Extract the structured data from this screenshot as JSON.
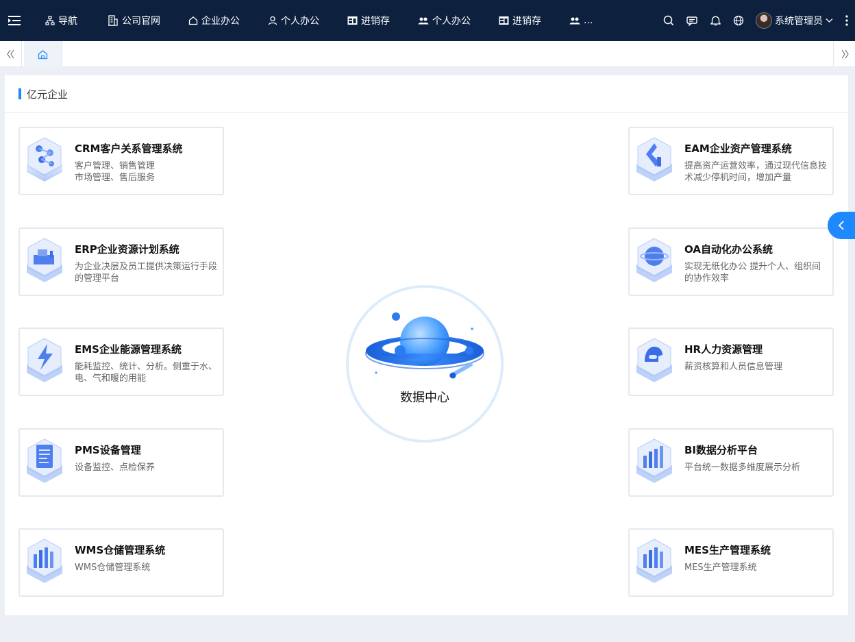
{
  "nav": {
    "items": [
      {
        "label": "导航",
        "icon": "sitemap-icon"
      },
      {
        "label": "公司官网",
        "icon": "building-icon"
      },
      {
        "label": "企业办公",
        "icon": "home-icon"
      },
      {
        "label": "个人办公",
        "icon": "user-icon"
      },
      {
        "label": "进销存",
        "icon": "board-icon"
      },
      {
        "label": "个人办公",
        "icon": "users-icon"
      },
      {
        "label": "进销存",
        "icon": "board-icon"
      },
      {
        "label": "...",
        "icon": "users-icon"
      }
    ]
  },
  "user": {
    "name": "系统管理员"
  },
  "panel": {
    "title": "亿元企业"
  },
  "center": {
    "title": "数据中心"
  },
  "cards_left": [
    {
      "title": "CRM客户关系管理系统",
      "desc": "客户管理、销售管理\n市场管理、售后服务",
      "icon": "crm-cube-icon"
    },
    {
      "title": "ERP企业资源计划系统",
      "desc": "为企业决层及员工提供决策运行手段的管理平台",
      "icon": "erp-cube-icon"
    },
    {
      "title": "EMS企业能源管理系统",
      "desc": "能耗监控、统计、分析。侧重于水、电、气和暖的用能",
      "icon": "ems-cube-icon"
    },
    {
      "title": "PMS设备管理",
      "desc": "设备监控、点检保养",
      "icon": "pms-cube-icon"
    },
    {
      "title": "WMS仓储管理系统",
      "desc": "WMS仓储管理系统",
      "icon": "wms-cube-icon"
    }
  ],
  "cards_right": [
    {
      "title": "EAM企业资产管理系统",
      "desc": "提高资产运营效率，通过现代信息技术减少停机时间，增加产量",
      "icon": "eam-cube-icon"
    },
    {
      "title": "OA自动化办公系统",
      "desc": "实现无纸化办公 提升个人、组织间的协作效率",
      "icon": "oa-cube-icon"
    },
    {
      "title": "HR人力资源管理",
      "desc": "薪资核算和人员信息管理",
      "icon": "hr-cube-icon"
    },
    {
      "title": "BI数据分析平台",
      "desc": "平台统一数据多维度展示分析",
      "icon": "bi-cube-icon"
    },
    {
      "title": "MES生产管理系统",
      "desc": "MES生产管理系统",
      "icon": "mes-cube-icon"
    }
  ],
  "colors": {
    "topbar": "#0d213f",
    "accent": "#1e88ff",
    "page_bg": "#eceff5"
  }
}
